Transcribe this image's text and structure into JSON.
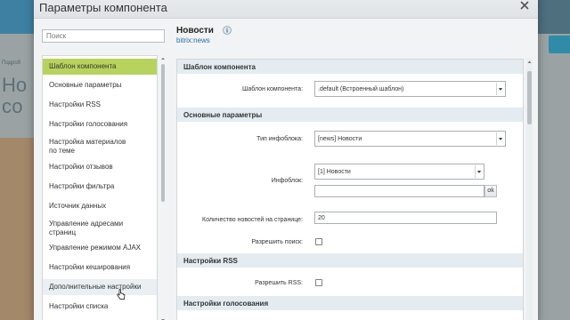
{
  "background": {
    "heading": "Но\nсо",
    "small_text": "Подроб"
  },
  "modal": {
    "title": "Параметры компонента"
  },
  "search": {
    "placeholder": "Поиск"
  },
  "sidebar": {
    "items": [
      {
        "label": "Шаблон компонента",
        "state": "active"
      },
      {
        "label": "Основные параметры",
        "state": ""
      },
      {
        "label": "Настройки RSS",
        "state": ""
      },
      {
        "label": "Настройки голосования",
        "state": ""
      },
      {
        "label": "Настройка материалов по теме",
        "state": ""
      },
      {
        "label": "Настройки отзывов",
        "state": ""
      },
      {
        "label": "Настройки фильтра",
        "state": ""
      },
      {
        "label": "Источник данных",
        "state": ""
      },
      {
        "label": "Управление адресами страниц",
        "state": ""
      },
      {
        "label": "Управление режимом AJAX",
        "state": ""
      },
      {
        "label": "Настройки кеширования",
        "state": ""
      },
      {
        "label": "Дополнительные настройки",
        "state": "hover"
      },
      {
        "label": "Настройки списка",
        "state": ""
      }
    ]
  },
  "component": {
    "title": "Новости",
    "code": "bitrix:news"
  },
  "sections": {
    "template": "Шаблон компонента",
    "basic": "Основные параметры",
    "rss": "Настройки RSS",
    "vote": "Настройки голосования"
  },
  "props": {
    "template_label": "Шаблон компонента:",
    "template_value": ".default (Встроенный шаблон)",
    "iblock_type_label": "Тип инфоблока:",
    "iblock_type_value": "[news] Новости",
    "iblock_label": "Инфоблок:",
    "iblock_value": "[1] Новости",
    "iblock_custom_value": "",
    "ok_label": "ok",
    "news_count_label": "Количество новостей на странице:",
    "news_count_value": "20",
    "allow_search_label": "Разрешить поиск:",
    "allow_rss_label": "Разрешить RSS:"
  }
}
